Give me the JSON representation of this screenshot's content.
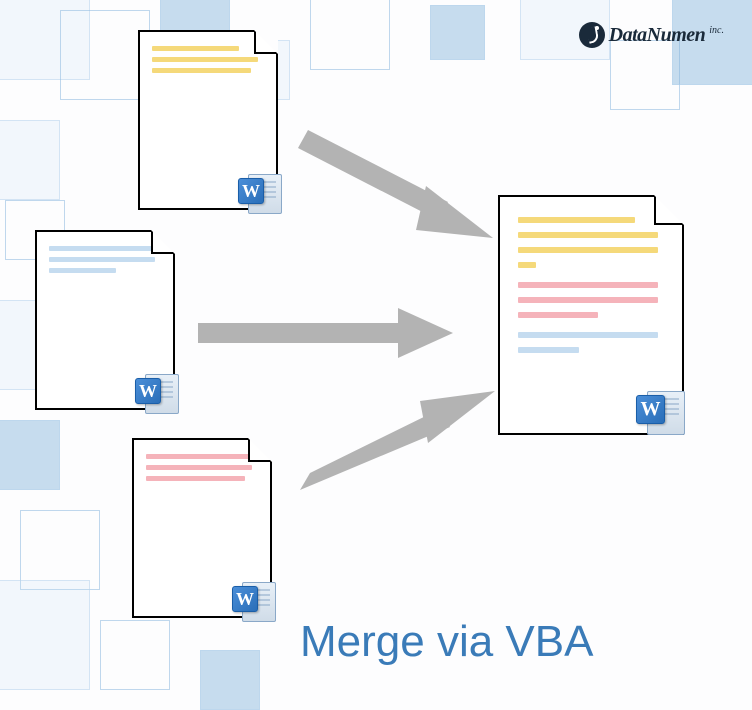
{
  "brand": {
    "name": "DataNumen",
    "suffix": "inc."
  },
  "caption": "Merge via VBA",
  "icons": {
    "word_letter": "W"
  },
  "diagram": {
    "sources": [
      {
        "id": "doc-yellow",
        "color": "yellow",
        "has_word_icon": true
      },
      {
        "id": "doc-blue",
        "color": "blue",
        "has_word_icon": true
      },
      {
        "id": "doc-pink",
        "color": "pink",
        "has_word_icon": true
      }
    ],
    "target": {
      "id": "doc-merged",
      "has_word_icon": true,
      "content_colors": [
        "yellow",
        "pink",
        "blue"
      ]
    },
    "arrows": 3,
    "concept": "Three Word documents merge into one combined Word document"
  }
}
